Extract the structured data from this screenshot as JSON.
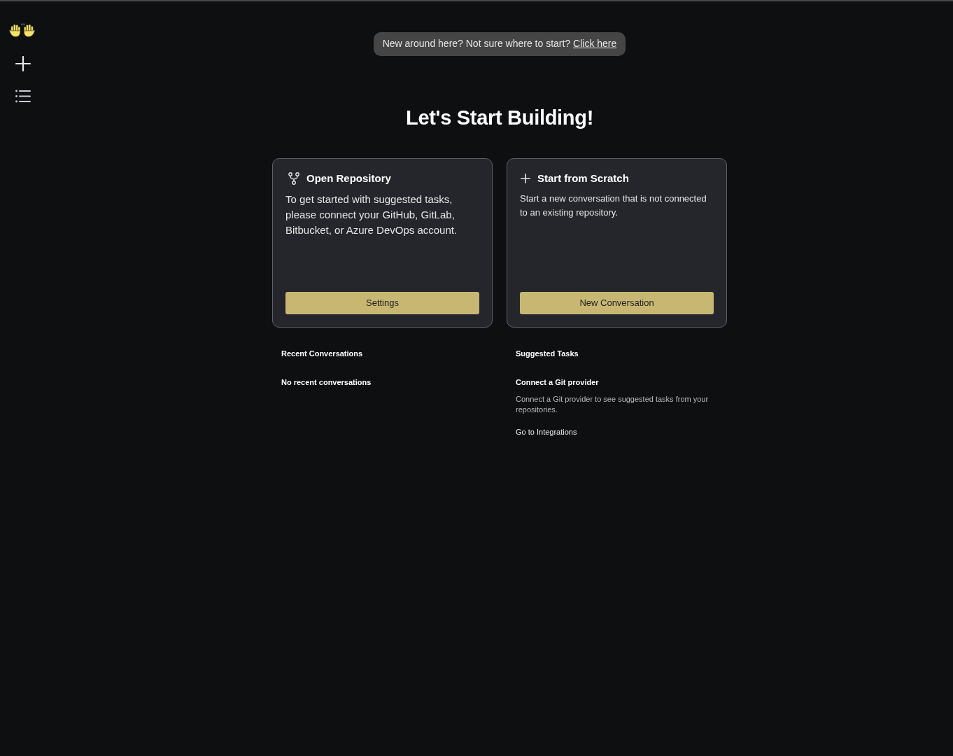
{
  "banner": {
    "text": "New around here? Not sure where to start?",
    "link": "Click here"
  },
  "heading": "Let's Start Building!",
  "cards": [
    {
      "kind": "repository",
      "title": "Open Repository",
      "description": "To get started with suggested tasks, please connect your GitHub, GitLab, Bitbucket, or Azure DevOps account.",
      "button": "Settings"
    },
    {
      "kind": "scratch",
      "title": "Start from Scratch",
      "description": "Start a new conversation that is not connected to an existing repository.",
      "button": "New Conversation"
    }
  ],
  "recent_conversations": {
    "title": "Recent Conversations",
    "empty_message": "No recent conversations"
  },
  "suggested_tasks": {
    "title": "Suggested Tasks",
    "items": [
      {
        "title": "Connect a Git provider",
        "description": "Connect a Git provider to see suggested tasks from your repositories.",
        "link": "Go to Integrations"
      }
    ]
  }
}
